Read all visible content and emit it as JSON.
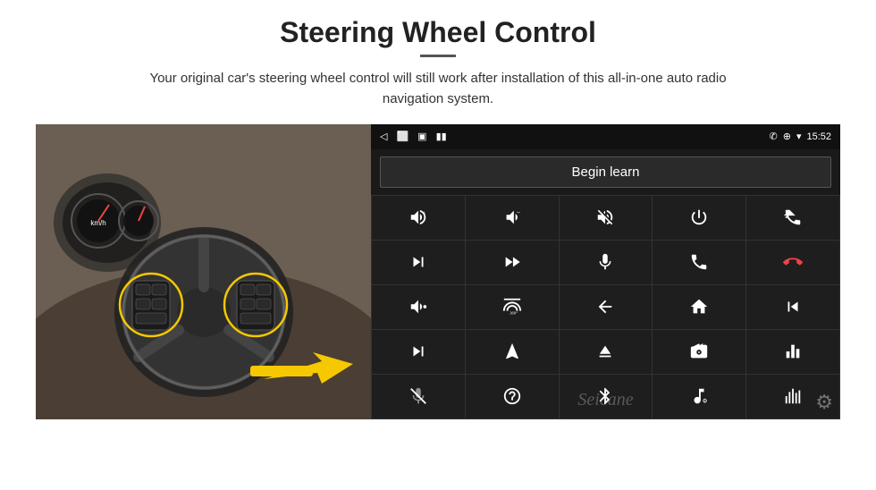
{
  "page": {
    "title": "Steering Wheel Control",
    "divider": true,
    "subtitle": "Your original car's steering wheel control will still work after installation of this all-in-one auto radio navigation system."
  },
  "status_bar": {
    "back_icon": "◁",
    "window_icon": "▭",
    "square_icon": "☐",
    "signal_icon": "▣",
    "phone_icon": "✆",
    "location_icon": "⊕",
    "wifi_icon": "▾",
    "time": "15:52"
  },
  "begin_learn": {
    "label": "Begin learn"
  },
  "controls": [
    {
      "icon": "vol_up",
      "unicode": ""
    },
    {
      "icon": "vol_down",
      "unicode": ""
    },
    {
      "icon": "mute",
      "unicode": ""
    },
    {
      "icon": "power",
      "unicode": ""
    },
    {
      "icon": "prev_track",
      "unicode": ""
    },
    {
      "icon": "skip_next",
      "unicode": ""
    },
    {
      "icon": "fast_forward",
      "unicode": ""
    },
    {
      "icon": "mic",
      "unicode": ""
    },
    {
      "icon": "phone",
      "unicode": ""
    },
    {
      "icon": "hang_up",
      "unicode": ""
    },
    {
      "icon": "horn",
      "unicode": ""
    },
    {
      "icon": "360_view",
      "unicode": ""
    },
    {
      "icon": "back",
      "unicode": ""
    },
    {
      "icon": "home",
      "unicode": ""
    },
    {
      "icon": "rewind",
      "unicode": ""
    },
    {
      "icon": "fast_fwd2",
      "unicode": ""
    },
    {
      "icon": "navigate",
      "unicode": ""
    },
    {
      "icon": "eject",
      "unicode": ""
    },
    {
      "icon": "radio",
      "unicode": ""
    },
    {
      "icon": "equalizer",
      "unicode": ""
    },
    {
      "icon": "mic2",
      "unicode": ""
    },
    {
      "icon": "settings2",
      "unicode": ""
    },
    {
      "icon": "bluetooth",
      "unicode": ""
    },
    {
      "icon": "music",
      "unicode": ""
    },
    {
      "icon": "bars",
      "unicode": ""
    }
  ],
  "watermark": "Seicane"
}
